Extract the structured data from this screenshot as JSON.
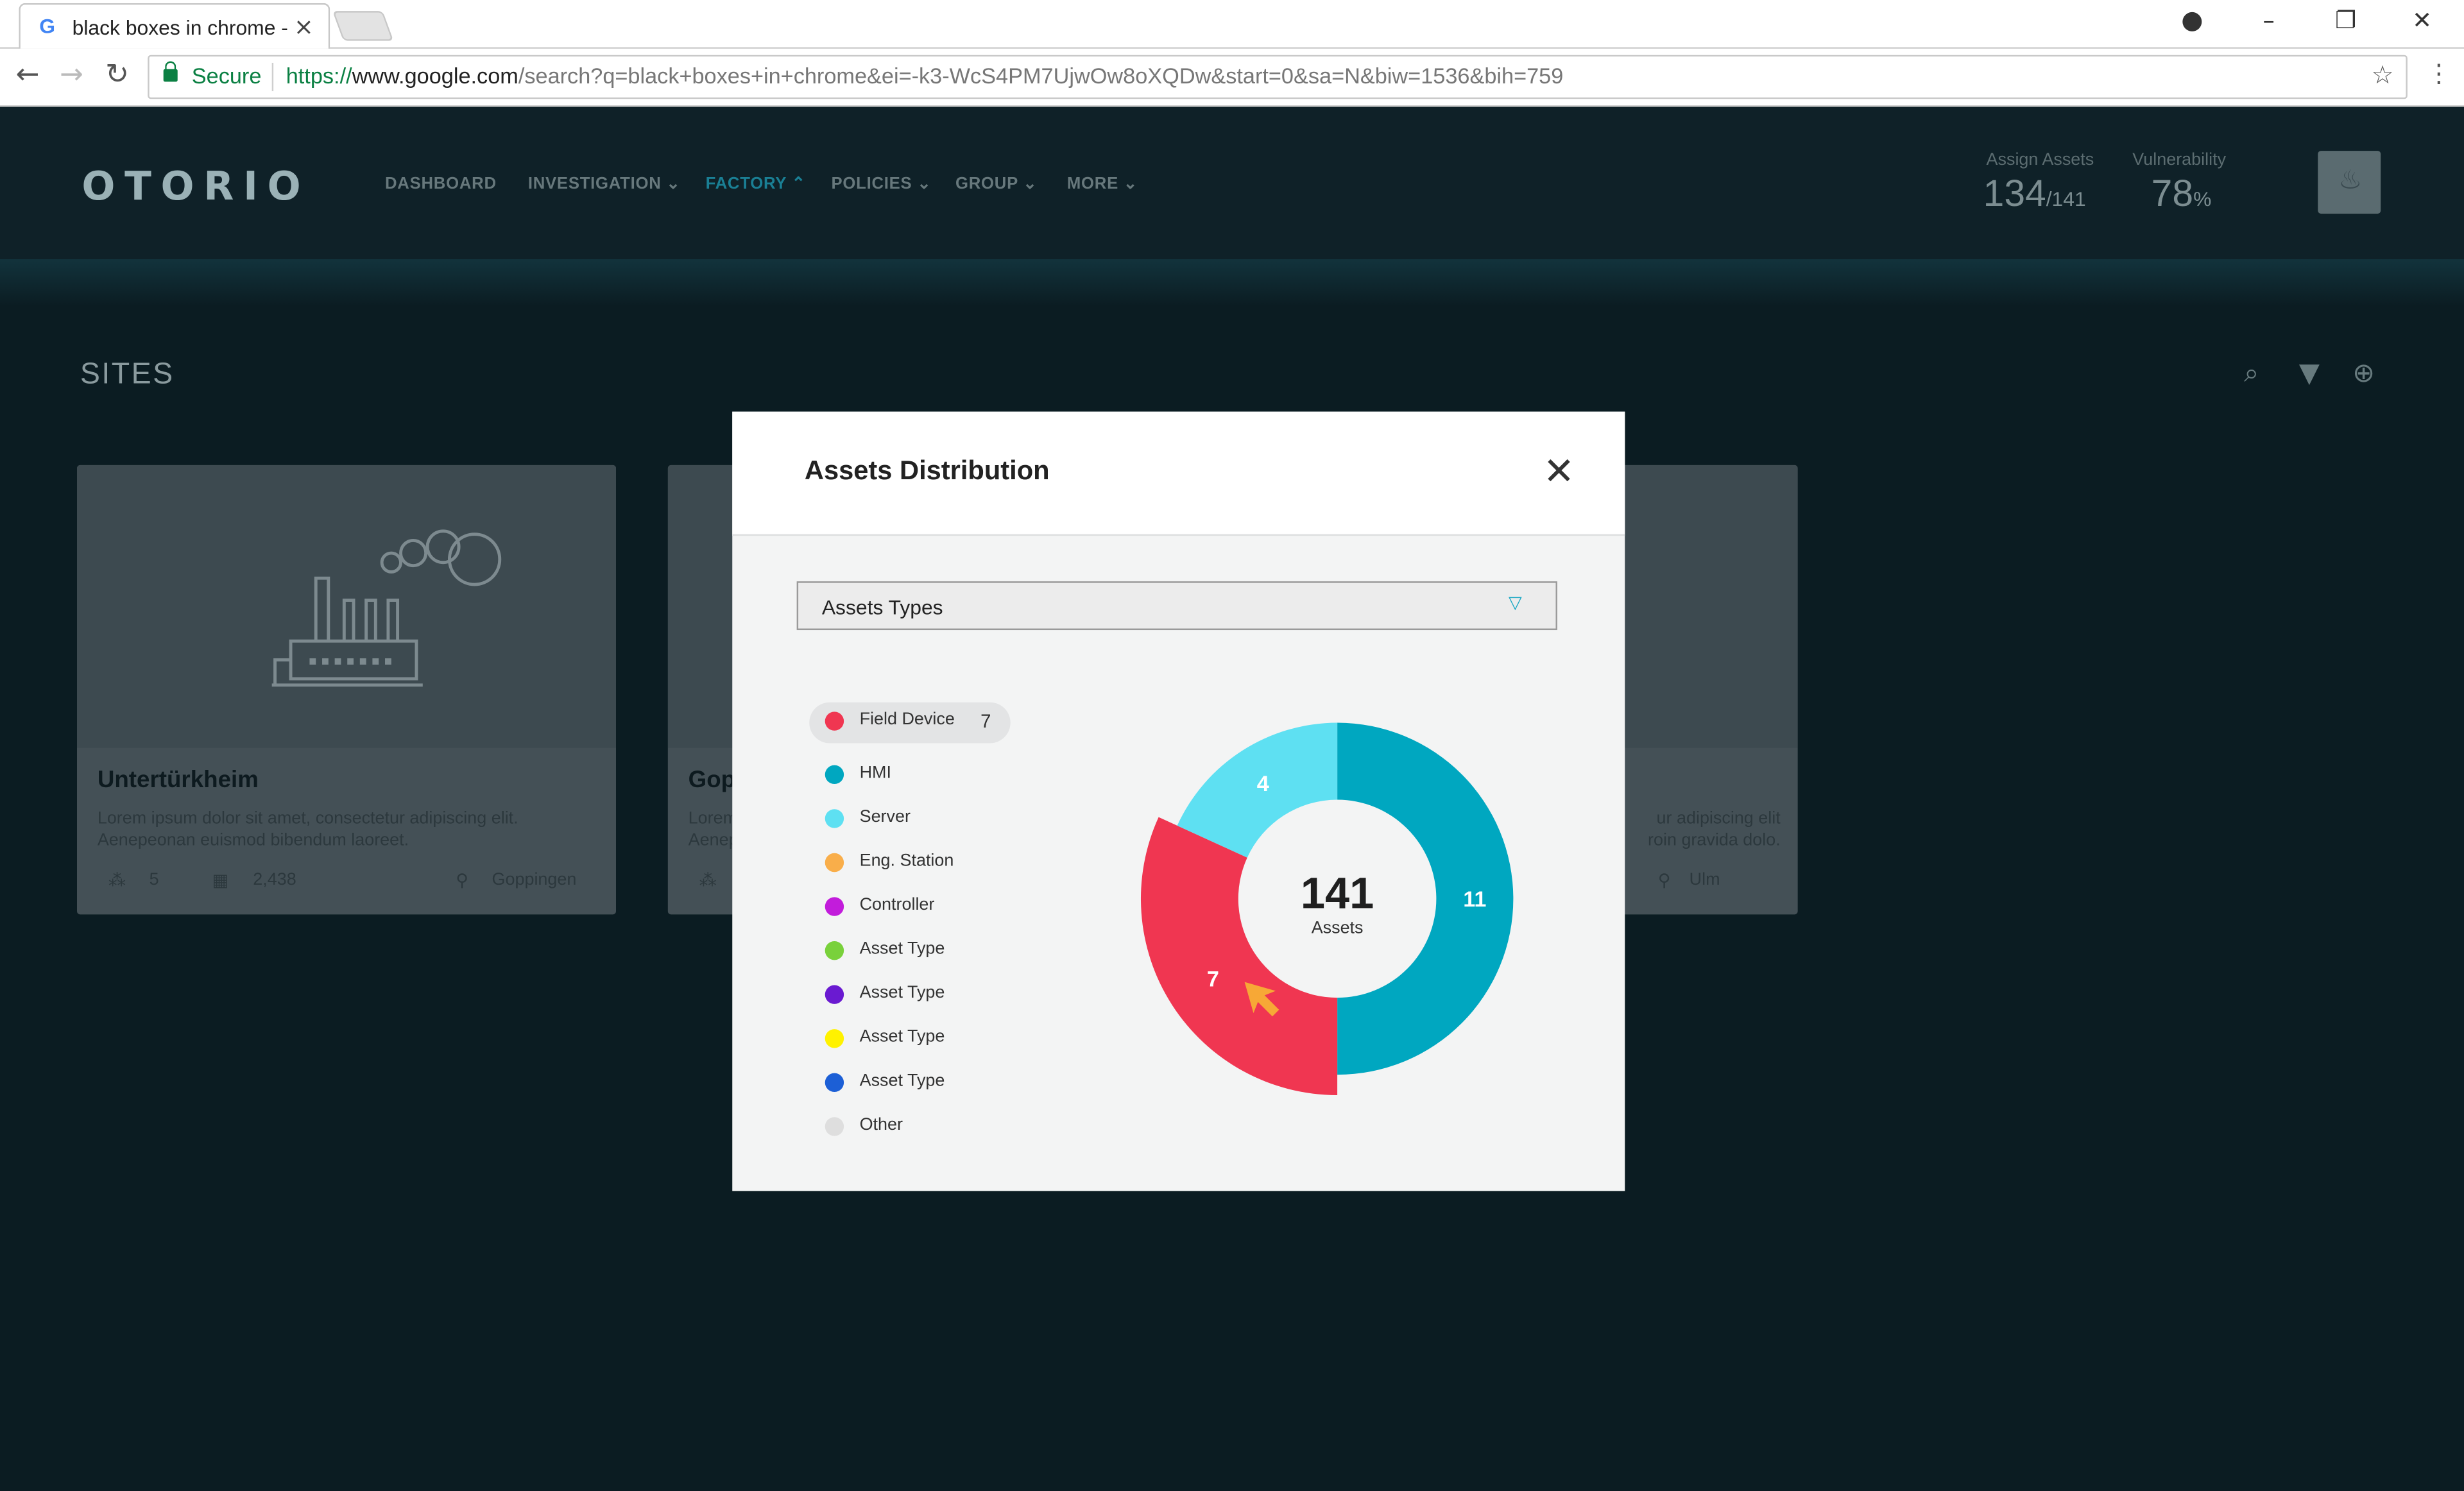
{
  "browser": {
    "tab_title": "black boxes in chrome - Google Search",
    "tab_favicon": "G",
    "secure_label": "Secure",
    "url_scheme": "https://",
    "url_host": "www.google.com",
    "url_path": "/search?q=black+boxes+in+chrome&ei=-k3-WcS4PM7UjwOw8oXQDw&start=0&sa=N&biw=1536&bih=759",
    "icons": [
      "back-icon",
      "forward-icon",
      "reload-icon",
      "lock-icon",
      "star-icon",
      "menu-icon",
      "account-icon",
      "minimize-icon",
      "restore-icon",
      "close-icon"
    ]
  },
  "app": {
    "logo": "OTORIO",
    "nav": [
      "DASHBOARD",
      "INVESTIGATION",
      "FACTORY",
      "POLICIES",
      "GROUP",
      "MORE"
    ],
    "active_nav": "FACTORY",
    "stats": {
      "assign_label": "Assign Assets",
      "assign_value": "134",
      "assign_total": "/141",
      "vuln_label": "Vulnerability",
      "vuln_value": "78",
      "vuln_unit": "%"
    },
    "section_title": "SITES",
    "cards": [
      {
        "title": "Untertürkheim",
        "desc": "Lorem ipsum dolor sit amet, consectetur adipiscing elit. Aenepeonan euismod bibendum laoreet.",
        "count_a": "5",
        "count_b": "2,438",
        "location": "Goppingen"
      },
      {
        "title": "Gop",
        "desc": "Lorem Aenep"
      },
      {
        "title": "",
        "desc": "ur adipiscing elit roin gravida dolo.",
        "location": "Ulm"
      }
    ]
  },
  "modal": {
    "title": "Assets Distribution",
    "select_value": "Assets Types",
    "legend": [
      {
        "label": "Field Device",
        "count": "7",
        "color": "#f03651",
        "selected": true
      },
      {
        "label": "HMI",
        "color": "#00a7c0"
      },
      {
        "label": "Server",
        "color": "#5ee0f2"
      },
      {
        "label": "Eng. Station",
        "color": "#f9ae4a"
      },
      {
        "label": "Controller",
        "color": "#c21cdb"
      },
      {
        "label": "Asset Type",
        "color": "#79d13b"
      },
      {
        "label": "Asset Type",
        "color": "#6a1ad1"
      },
      {
        "label": "Asset Type",
        "color": "#fff200"
      },
      {
        "label": "Asset Type",
        "color": "#1c5fd6"
      },
      {
        "label": "Other",
        "color": "#dedede"
      }
    ],
    "center_value": "141",
    "center_label": "Assets"
  },
  "chart_data": {
    "type": "pie",
    "variant": "donut",
    "categories": [
      "HMI",
      "Field Device",
      "Server"
    ],
    "values": [
      11,
      7,
      4
    ],
    "colors": [
      "#00a7c0",
      "#f03651",
      "#5ee0f2"
    ],
    "highlighted": "Field Device",
    "center_text": "141",
    "center_subtext": "Assets"
  }
}
